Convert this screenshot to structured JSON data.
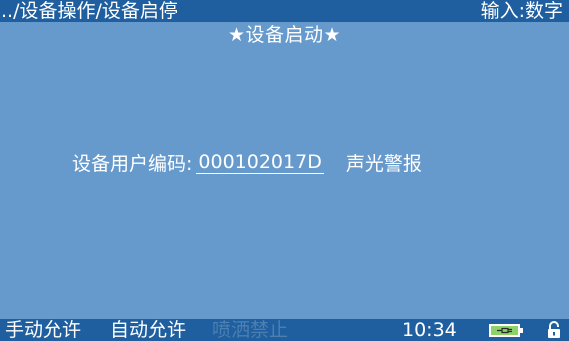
{
  "header": {
    "path": "../设备操作/设备启停",
    "input_mode": "输入:数字"
  },
  "screen": {
    "title": "★设备启动★"
  },
  "device": {
    "code_label": "设备用户编码:",
    "code_value": "000102017D",
    "alarm_label": "声光警报"
  },
  "footer": {
    "softkeys": [
      {
        "label": "手动允许",
        "enabled": true
      },
      {
        "label": "自动允许",
        "enabled": true
      },
      {
        "label": "喷洒禁止",
        "enabled": false
      }
    ],
    "time": "10:34",
    "icons": [
      "battery-charging-icon",
      "lock-open-icon"
    ],
    "colors": {
      "bar": "#1f5f9f",
      "background": "#6699cc",
      "battery_fill": "#8fd16a",
      "disabled_text": "#4d7fb0"
    }
  }
}
